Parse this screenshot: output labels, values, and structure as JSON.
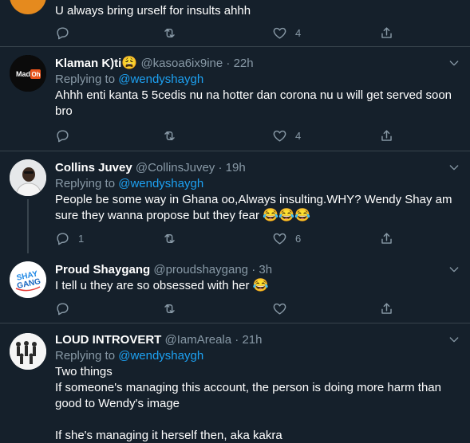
{
  "colors": {
    "background": "#15202b",
    "border": "#38444d",
    "secondary_text": "#8899a6",
    "accent": "#1da1f2"
  },
  "tweets": [
    {
      "body": [
        "U always bring urself for insults ahhh"
      ],
      "likes": "4"
    },
    {
      "name": "Klaman K)ti",
      "name_emoji": "😩",
      "handle": "@kasoa6ix9ine",
      "separator": "·",
      "time": "22h",
      "replying_label": "Replying to",
      "replying_to": "@wendyshaygh",
      "body": [
        "Ahhh enti kanta 5 5cedis nu na hotter dan corona nu u will get served soon bro"
      ],
      "avatar_text": "Mad",
      "avatar_badge": "Oh",
      "likes": "4"
    },
    {
      "name": "Collins Juvey",
      "handle": "@CollinsJuvey",
      "separator": "·",
      "time": "19h",
      "replying_label": "Replying to",
      "replying_to": "@wendyshaygh",
      "body": [
        "People be some way in Ghana oo,Always insulting.WHY? Wendy Shay am sure they wanna propose but they fear"
      ],
      "body_emoji": "😂😂😂",
      "replies": "1",
      "likes": "6"
    },
    {
      "name": "Proud Shaygang",
      "handle": "@proudshaygang",
      "separator": "·",
      "time": "3h",
      "body": [
        "I tell u they are so obsessed with her"
      ],
      "body_emoji": "😂",
      "avatar_text_top": "SHAY",
      "avatar_text_bottom": "GANG"
    },
    {
      "name": "LOUD INTROVERT",
      "handle": "@IamAreala",
      "separator": "·",
      "time": "21h",
      "replying_label": "Replying to",
      "replying_to": "@wendyshaygh",
      "body": [
        "Two things",
        "If someone's managing this account, the person is doing more harm than good to Wendy's image",
        "",
        "If she's managing it herself then, aka kakra"
      ]
    }
  ]
}
